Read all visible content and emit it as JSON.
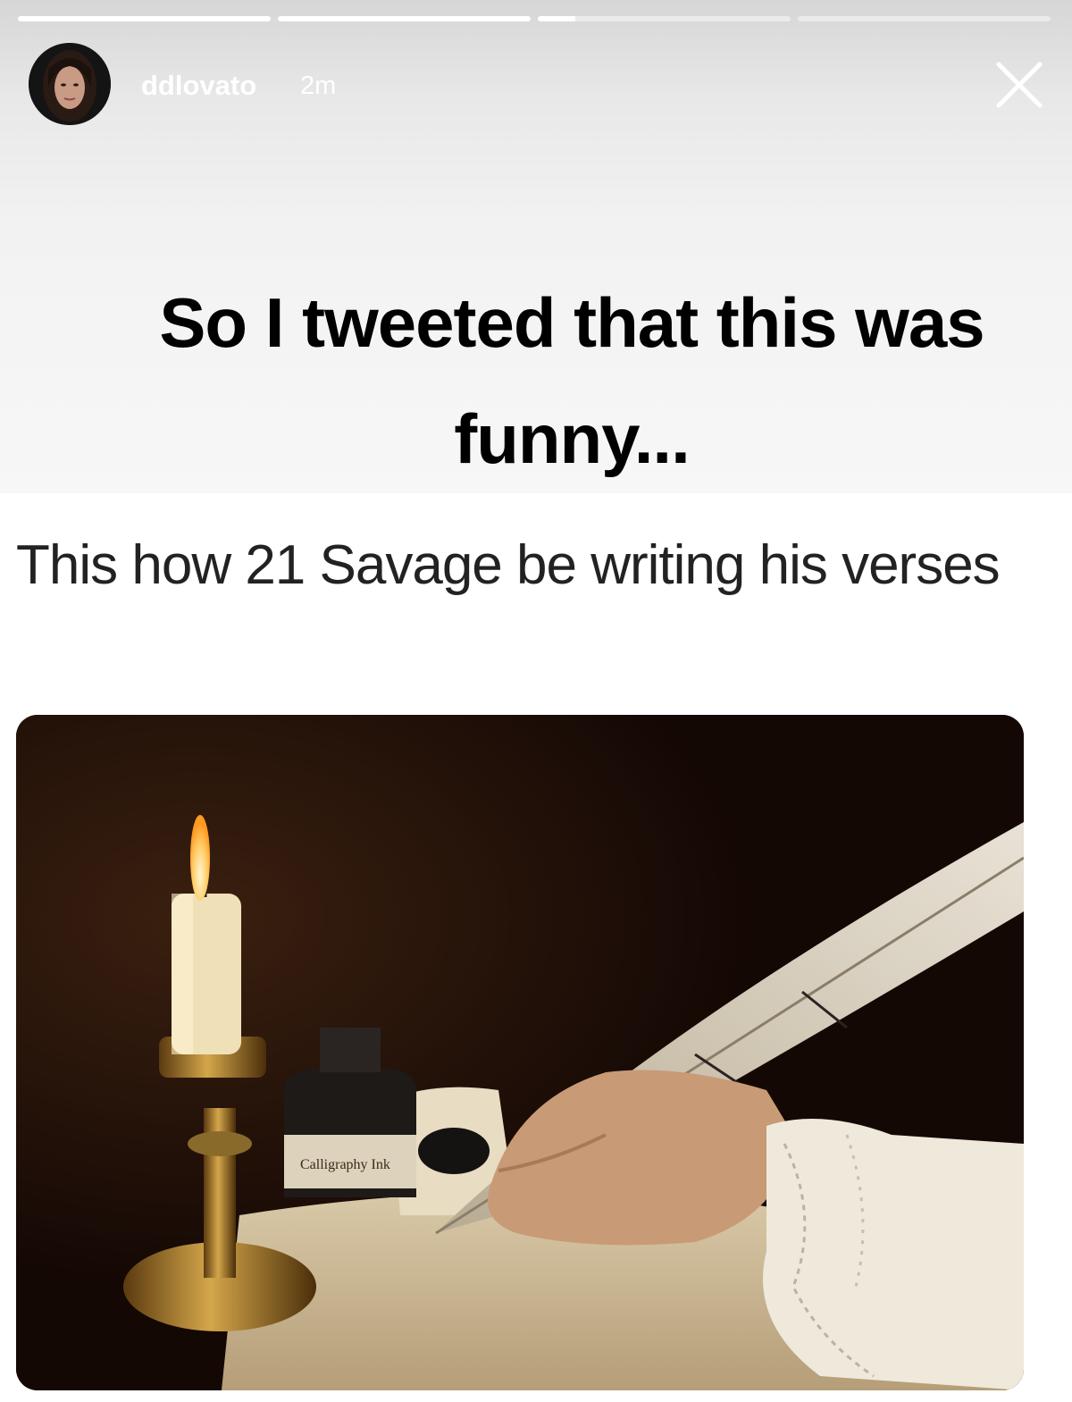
{
  "story": {
    "progress": [
      1,
      1,
      0.15,
      0,
      0
    ],
    "user": {
      "username": "ddlovato",
      "time": "2m"
    },
    "caption": "So I tweeted that this was funny...",
    "tweet": {
      "text": "This how 21 Savage be writing his verses"
    },
    "image": {
      "ink_label": "Calligraphy Ink"
    }
  },
  "icons": {
    "close": "close-icon"
  }
}
